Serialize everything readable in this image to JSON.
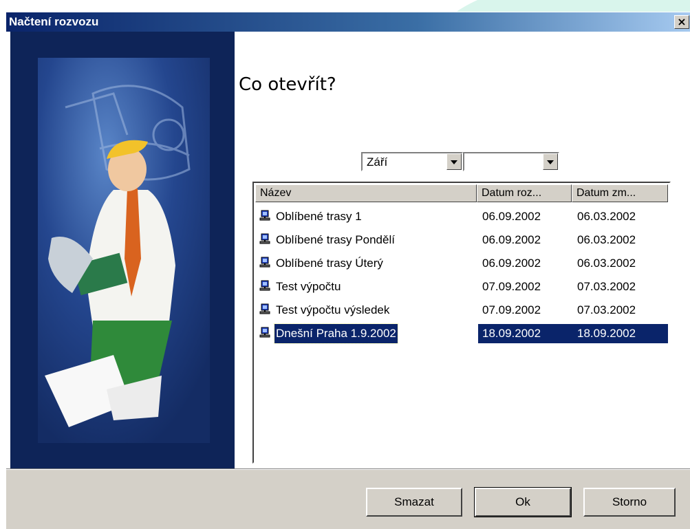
{
  "window": {
    "title": "Načtení rozvozu",
    "close_glyph": "×"
  },
  "main": {
    "question": "Co otevřít?"
  },
  "filters": {
    "month": "Září",
    "second": ""
  },
  "table": {
    "columns": [
      "Název",
      "Datum roz...",
      "Datum zm..."
    ],
    "rows": [
      {
        "name": "Oblíbené trasy 1",
        "created": "06.09.2002",
        "modified": "06.03.2002",
        "icon": "route-file-icon"
      },
      {
        "name": "Oblíbené trasy Pondělí",
        "created": "06.09.2002",
        "modified": "06.03.2002",
        "icon": "route-file-icon"
      },
      {
        "name": "Oblíbené trasy Úterý",
        "created": "06.09.2002",
        "modified": "06.03.2002",
        "icon": "route-file-icon"
      },
      {
        "name": "Test výpočtu",
        "created": "07.09.2002",
        "modified": "07.03.2002",
        "icon": "route-file-icon"
      },
      {
        "name": "Test výpočtu výsledek",
        "created": "07.09.2002",
        "modified": "07.03.2002",
        "icon": "route-file-icon"
      },
      {
        "name": "Dnešní Praha 1.9.2002",
        "created": "18.09.2002",
        "modified": "18.09.2002",
        "icon": "route-file-icon"
      }
    ],
    "selected_index": 5
  },
  "buttons": {
    "delete": "Smazat",
    "ok": "Ok",
    "cancel": "Storno"
  },
  "colors": {
    "titlebar_start": "#0a246a",
    "titlebar_end": "#a6caf0",
    "selection": "#0a246a",
    "picture_bg": "#1a3a7a"
  }
}
